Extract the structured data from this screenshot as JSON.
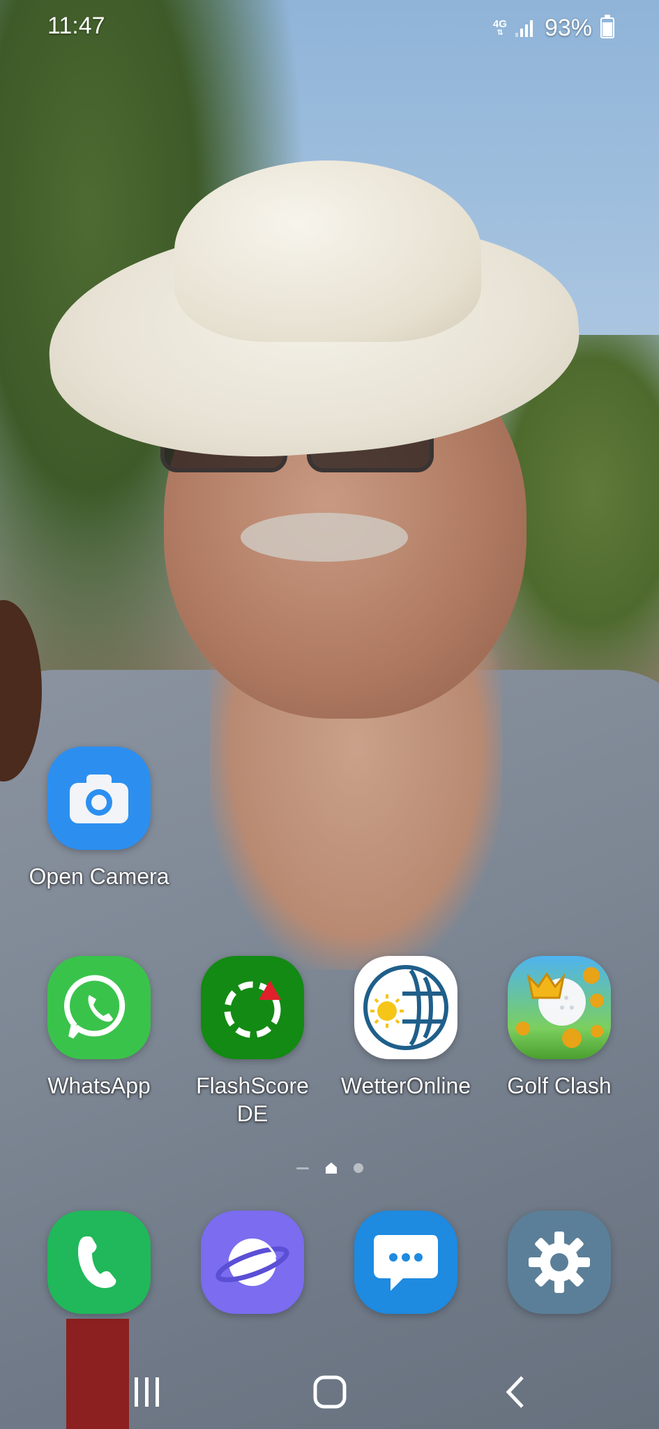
{
  "status_bar": {
    "time": "11:47",
    "network": "4G",
    "battery_percent": "93%",
    "battery_level": 0.93
  },
  "home_apps": [
    {
      "label": "Open Camera",
      "icon": "camera-icon",
      "color": "#2c8ff0"
    }
  ],
  "app_row": [
    {
      "label": "WhatsApp",
      "icon": "whatsapp-icon",
      "color": "#3ac34b"
    },
    {
      "label": "FlashScore DE",
      "icon": "flashscore-icon",
      "color": "#138a13"
    },
    {
      "label": "WetterOnline",
      "icon": "wetteronline-icon",
      "color": "#ffffff"
    },
    {
      "label": "Golf Clash",
      "icon": "golf-clash-icon",
      "color": "#4fb3f0"
    }
  ],
  "dock": [
    {
      "name": "phone",
      "icon": "phone-icon",
      "color": "#20b85a"
    },
    {
      "name": "internet",
      "icon": "planet-icon",
      "color": "#7b6cf0"
    },
    {
      "name": "messages",
      "icon": "message-icon",
      "color": "#1e8ae0"
    },
    {
      "name": "settings",
      "icon": "gear-icon",
      "color": "#5b7f98"
    }
  ],
  "page_indicator": {
    "pages": 3,
    "current": 1
  },
  "navigation": [
    "recents-button",
    "home-button",
    "back-button"
  ]
}
